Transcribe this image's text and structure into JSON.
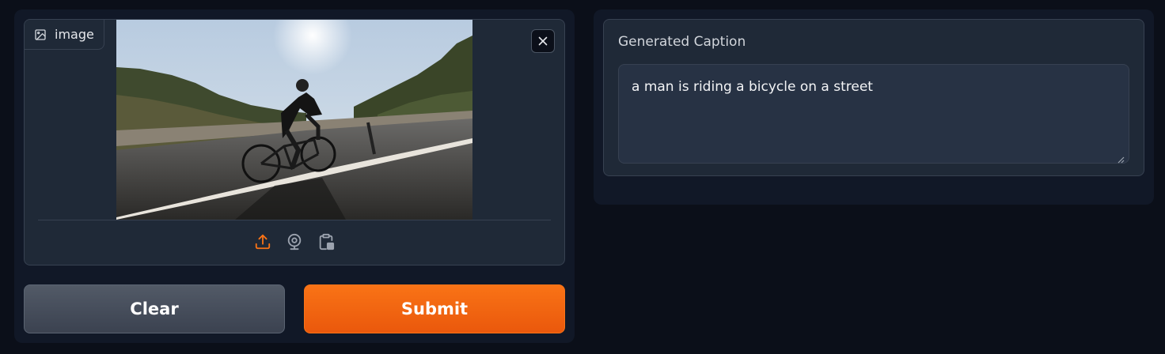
{
  "image_input": {
    "label": "image",
    "icon": "image-icon",
    "close_icon": "close-icon",
    "sources": [
      {
        "name": "upload",
        "icon": "upload-icon",
        "active": true
      },
      {
        "name": "webcam",
        "icon": "webcam-icon",
        "active": false
      },
      {
        "name": "clipboard",
        "icon": "clipboard-icon",
        "active": false
      }
    ]
  },
  "actions": {
    "clear_label": "Clear",
    "submit_label": "Submit"
  },
  "output": {
    "label": "Generated Caption",
    "value": "a man is riding a bicycle on a street"
  },
  "colors": {
    "accent": "#f97316",
    "background": "#0b0f19",
    "panel": "#111827",
    "block": "#1f2937"
  }
}
